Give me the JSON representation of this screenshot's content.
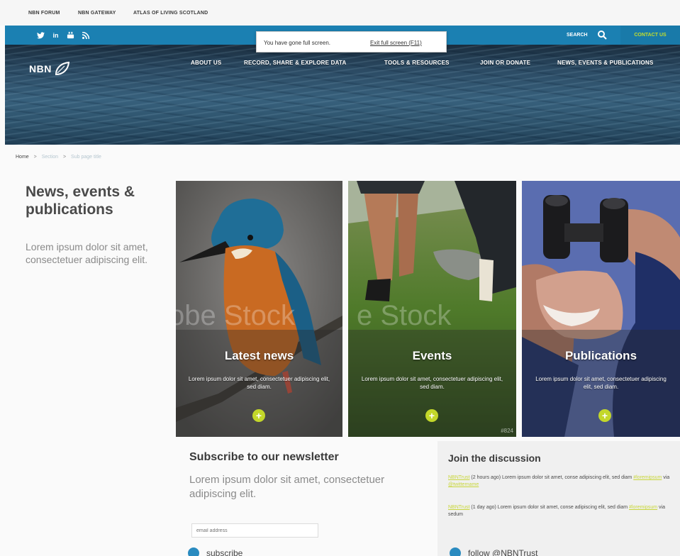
{
  "utility_links": [
    "NBN FORUM",
    "NBN GATEWAY",
    "ATLAS OF LIVING SCOTLAND"
  ],
  "social_icons": [
    "twitter-icon",
    "linkedin-icon",
    "youtube-icon",
    "rss-icon"
  ],
  "social_glyphs": [
    "🐦",
    "in",
    "▣",
    "☰"
  ],
  "header": {
    "search_label": "SEARCH",
    "contact_label": "CONTACT US"
  },
  "fullscreen": {
    "message": "You have gone full screen.",
    "exit_label": "Exit full screen (F11)"
  },
  "logo": {
    "text": "NBN"
  },
  "nav": [
    "ABOUT US",
    "RECORD, SHARE & EXPLORE DATA",
    "TOOLS & RESOURCES",
    "JOIN OR DONATE",
    "NEWS, EVENTS & PUBLICATIONS"
  ],
  "breadcrumb": {
    "home": "Home",
    "sep": ">",
    "section": "Section",
    "subpage": "Sub page title"
  },
  "page": {
    "title": "News, events & publications",
    "intro": "Lorem ipsum dolor sit amet, consectetuer adipiscing elit."
  },
  "tiles": [
    {
      "title": "Latest news",
      "desc": "Lorem ipsum dolor sit amet, consectetuer adipiscing elit, sed diam.",
      "plus": "+"
    },
    {
      "title": "Events",
      "desc": "Lorem ipsum dolor sit amet, consectetuer adipiscing elit, sed diam.",
      "plus": "+"
    },
    {
      "title": "Publications",
      "desc": "Lorem ipsum dolor sit amet, consectetuer adipiscing elit, sed diam.",
      "plus": "+"
    }
  ],
  "watermark": {
    "left": "obe Stock",
    "mid": "e Stock",
    "corner": "#824"
  },
  "newsletter": {
    "title": "Subscribe to our newsletter",
    "text": "Lorem ipsum dolor sit amet, consectetuer adipiscing elit.",
    "email_placeholder": "email address",
    "subscribe_label": "subscribe"
  },
  "discussion": {
    "title": "Join the discussion",
    "tweets": [
      {
        "handle": "NBNTrust",
        "time": "(2 hours ago)",
        "text": "Lorem ipsum dolor sit amet, conse adipiscing elit, sed diam",
        "tag": "#loremipsum",
        "via": "via",
        "source": "@twittername"
      },
      {
        "handle": "NBNTrust",
        "time": "(1 day ago)",
        "text": "Lorem ipsum dolor sit amet, conse adipiscing elit, sed diam",
        "tag": "#loremipsum",
        "via": "via sedum",
        "source": ""
      }
    ],
    "follow_label": "follow @NBNTrust"
  },
  "colors": {
    "brand_blue": "#1b80b2",
    "accent_lime": "#c3d72a"
  }
}
